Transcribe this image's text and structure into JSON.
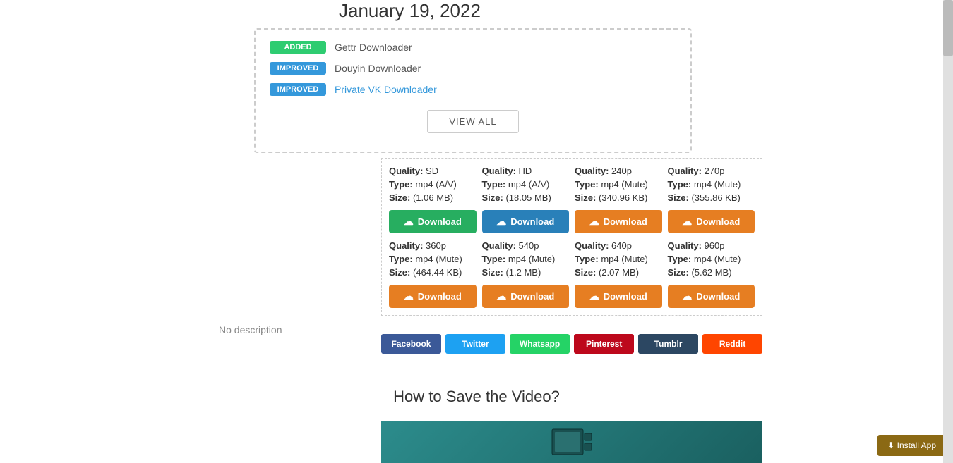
{
  "date": "January 19, 2022",
  "changelog": {
    "items": [
      {
        "badge": "ADDED",
        "badge_type": "added",
        "text": "Gettr Downloader",
        "is_link": false
      },
      {
        "badge": "IMPROVED",
        "badge_type": "improved",
        "text": "Douyin Downloader",
        "is_link": false
      },
      {
        "badge": "IMPROVED",
        "badge_type": "improved",
        "text": "Private VK Downloader",
        "is_link": true
      }
    ],
    "view_all_label": "VIEW ALL"
  },
  "downloads": {
    "row1": [
      {
        "quality_label": "Quality:",
        "quality_val": "SD",
        "type_label": "Type:",
        "type_val": "mp4 (A/V)",
        "size_label": "Size:",
        "size_val": "(1.06 MB)",
        "btn_label": "Download",
        "btn_color": "green"
      },
      {
        "quality_label": "Quality:",
        "quality_val": "HD",
        "type_label": "Type:",
        "type_val": "mp4 (A/V)",
        "size_label": "Size:",
        "size_val": "(18.05 MB)",
        "btn_label": "Download",
        "btn_color": "blue"
      },
      {
        "quality_label": "Quality:",
        "quality_val": "240p",
        "type_label": "Type:",
        "type_val": "mp4 (Mute)",
        "size_label": "Size:",
        "size_val": "(340.96 KB)",
        "btn_label": "Download",
        "btn_color": "orange"
      },
      {
        "quality_label": "Quality:",
        "quality_val": "270p",
        "type_label": "Type:",
        "type_val": "mp4 (Mute)",
        "size_label": "Size:",
        "size_val": "(355.86 KB)",
        "btn_label": "Download",
        "btn_color": "orange"
      }
    ],
    "row2": [
      {
        "quality_label": "Quality:",
        "quality_val": "360p",
        "type_label": "Type:",
        "type_val": "mp4 (Mute)",
        "size_label": "Size:",
        "size_val": "(464.44 KB)",
        "btn_label": "Download",
        "btn_color": "orange"
      },
      {
        "quality_label": "Quality:",
        "quality_val": "540p",
        "type_label": "Type:",
        "type_val": "mp4 (Mute)",
        "size_label": "Size:",
        "size_val": "(1.2 MB)",
        "btn_label": "Download",
        "btn_color": "orange"
      },
      {
        "quality_label": "Quality:",
        "quality_val": "640p",
        "type_label": "Type:",
        "type_val": "mp4 (Mute)",
        "size_label": "Size:",
        "size_val": "(2.07 MB)",
        "btn_label": "Download",
        "btn_color": "orange"
      },
      {
        "quality_label": "Quality:",
        "quality_val": "960p",
        "type_label": "Type:",
        "type_val": "mp4 (Mute)",
        "size_label": "Size:",
        "size_val": "(5.62 MB)",
        "btn_label": "Download",
        "btn_color": "orange"
      }
    ]
  },
  "social_buttons": [
    {
      "label": "Facebook",
      "color": "facebook"
    },
    {
      "label": "Twitter",
      "color": "twitter"
    },
    {
      "label": "Whatsapp",
      "color": "whatsapp"
    },
    {
      "label": "Pinterest",
      "color": "pinterest"
    },
    {
      "label": "Tumblr",
      "color": "tumblr"
    },
    {
      "label": "Reddit",
      "color": "reddit"
    }
  ],
  "no_description": "No description",
  "how_to_title": "How to Save the Video?",
  "install_app_label": "⬇ Install App",
  "cloud_icon": "☁",
  "colors": {
    "green": "#27ae60",
    "blue": "#2980b9",
    "orange": "#e67e22",
    "facebook": "#3b5998",
    "twitter": "#1da1f2",
    "whatsapp": "#25d366",
    "pinterest": "#bd081c",
    "tumblr": "#2c4762",
    "reddit": "#ff4500"
  }
}
